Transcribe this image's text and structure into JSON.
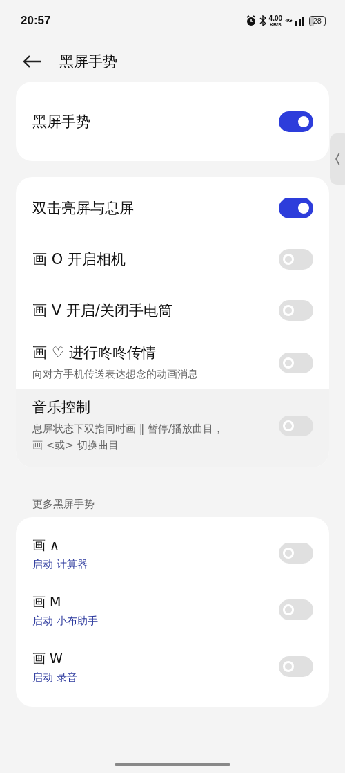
{
  "status_bar": {
    "time": "20:57",
    "speed": "4.00",
    "speed_unit": "KB/S",
    "network": "4G",
    "battery": "28"
  },
  "header": {
    "title": "黑屏手势"
  },
  "master": {
    "label": "黑屏手势",
    "on": true
  },
  "gestures": [
    {
      "kind": "plain",
      "label": "双击亮屏与息屏",
      "on": true,
      "selected": false
    },
    {
      "kind": "plain",
      "label": "画 O 开启相机",
      "on": false,
      "selected": false
    },
    {
      "kind": "plain",
      "label": "画 V 开启/关闭手电筒",
      "on": false,
      "selected": false
    },
    {
      "kind": "divided",
      "label": "画 ♡ 进行咚咚传情",
      "description": "向对方手机传送表达想念的动画消息",
      "on": false,
      "selected": false
    },
    {
      "kind": "plain",
      "label": "音乐控制",
      "description": "息屏状态下双指同时画 ‖ 暂停/播放曲目，画 <或> 切换曲目",
      "on": false,
      "selected": true
    }
  ],
  "more_section": {
    "title": "更多黑屏手势"
  },
  "more_gestures": [
    {
      "kind": "divided",
      "label": "画 ∧",
      "action": "启动 计算器",
      "on": false
    },
    {
      "kind": "divided",
      "label": "画 M",
      "action": "启动 小布助手",
      "on": false
    },
    {
      "kind": "divided",
      "label": "画 W",
      "action": "启动 录音",
      "on": false
    }
  ]
}
